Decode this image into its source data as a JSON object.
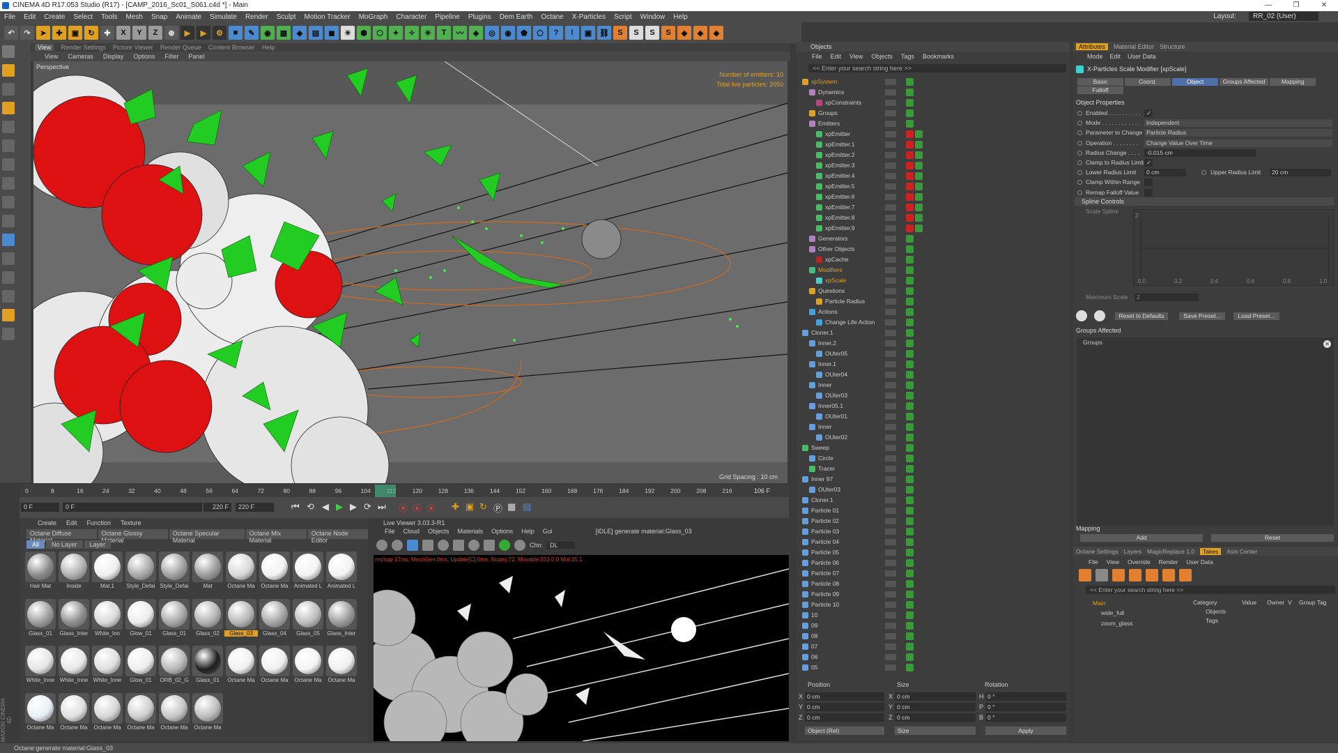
{
  "window": {
    "title": "CINEMA 4D R17.053 Studio (R17) - [CAMP_2016_Sc01_S061.c4d *] - Main"
  },
  "menu": [
    "File",
    "Edit",
    "Create",
    "Select",
    "Tools",
    "Mesh",
    "Snap",
    "Animate",
    "Simulate",
    "Render",
    "Sculpt",
    "Motion Tracker",
    "MoGraph",
    "Character",
    "Pipeline",
    "Plugins",
    "Dem Earth",
    "Octane",
    "X-Particles",
    "Script",
    "Window",
    "Help"
  ],
  "layout": {
    "label": "Layout:",
    "value": "RR_02 (User)"
  },
  "viewport": {
    "tabs": [
      "View",
      "Render Settings",
      "Picture Viewer",
      "Render Queue",
      "Content Browser",
      "Help"
    ],
    "menu": [
      "View",
      "Cameras",
      "Display",
      "Options",
      "Filter",
      "Panel"
    ],
    "name": "Perspective",
    "emitters": "Number of emitters: 10",
    "particles": "Total live particles: 2050",
    "grid": "Grid Spacing : 10 cm"
  },
  "timeline": {
    "ticks": [
      "0",
      "8",
      "16",
      "24",
      "32",
      "40",
      "48",
      "56",
      "64",
      "72",
      "80",
      "88",
      "96",
      "104",
      "112",
      "120",
      "128",
      "136",
      "144",
      "152",
      "160",
      "168",
      "176",
      "184",
      "192",
      "200",
      "208",
      "216"
    ],
    "current": "106",
    "end_label": "106 F",
    "start_field": "0 F",
    "min_field": "0 F",
    "max_field": "220 F",
    "end_field": "220 F"
  },
  "materials": {
    "menu": [
      "Create",
      "Edit",
      "Function",
      "Texture"
    ],
    "tabs": [
      "Octane Diffuse Material",
      "Octane Glossy Material",
      "Octane Specular Material",
      "Octane Mix Material",
      "Octane Node Editor"
    ],
    "filters": [
      "All",
      "No Layer",
      "Layer"
    ],
    "items": [
      {
        "name": "Hair Mat",
        "c": "#8a8a8a"
      },
      {
        "name": "Inside",
        "c": "#b0b0b0"
      },
      {
        "name": "Mat.1",
        "c": "#f0f0f0"
      },
      {
        "name": "Style_Defai",
        "c": "#a8a8a8"
      },
      {
        "name": "Style_Defai",
        "c": "#a0a0a0"
      },
      {
        "name": "Mat",
        "c": "#9a9a9a"
      },
      {
        "name": "Octane Ma",
        "c": "#d8d8d8"
      },
      {
        "name": "Octane Ma",
        "c": "#f2f2f2"
      },
      {
        "name": "Animated L",
        "c": "#f2f2f2"
      },
      {
        "name": "Animated L",
        "c": "#f2f2f2"
      },
      {
        "name": "Glass_01",
        "c": "#9c9c9c"
      },
      {
        "name": "Glass_Inter",
        "c": "#8c8c8c"
      },
      {
        "name": "White_Inn",
        "c": "#dadada"
      },
      {
        "name": "Glow_01",
        "c": "#ececec"
      },
      {
        "name": "Glass_01",
        "c": "#a6a6a6"
      },
      {
        "name": "Glass_02",
        "c": "#b2b2b2"
      },
      {
        "name": "Glass_03",
        "c": "#b6b6b6",
        "sel": true
      },
      {
        "name": "Glass_04",
        "c": "#a4a4a4"
      },
      {
        "name": "Glass_05",
        "c": "#bdbdbd"
      },
      {
        "name": "Glass_Inter",
        "c": "#9a9a9a"
      },
      {
        "name": "White_Inne",
        "c": "#e4e4e4"
      },
      {
        "name": "White_Inne",
        "c": "#e8e8e8"
      },
      {
        "name": "White_Inne",
        "c": "#dedede"
      },
      {
        "name": "Glow_01",
        "c": "#eeeeee"
      },
      {
        "name": "ORB_02_G",
        "c": "#b8b8b8"
      },
      {
        "name": "Glass_01",
        "c": "#1e1e1e"
      },
      {
        "name": "Octane Ma",
        "c": "#f0f0f0"
      },
      {
        "name": "Octane Ma",
        "c": "#f0f0f0"
      },
      {
        "name": "Octane Ma",
        "c": "#f4f4f4"
      },
      {
        "name": "Octane Ma",
        "c": "#f0f0f0"
      },
      {
        "name": "Octane Ma",
        "c": "#e6f0f6"
      },
      {
        "name": "Octane Ma",
        "c": "#e0e0e0"
      },
      {
        "name": "Octane Ma",
        "c": "#d6d6d6"
      },
      {
        "name": "Octane Ma",
        "c": "#cfcfcf"
      },
      {
        "name": "Octane Ma",
        "c": "#c6c6c6"
      },
      {
        "name": "Octane Ma",
        "c": "#bcbcbc"
      }
    ]
  },
  "liveviewer": {
    "title": "Live Viewer 3.03.3-R1",
    "menu": [
      "File",
      "Cloud",
      "Objects",
      "Materials",
      "Options",
      "Help",
      "Gui"
    ],
    "status": "[IDLE] generate material:Glass_03",
    "chn_label": "Chn:",
    "chn": "DL",
    "msg": "ms/spp 17ms, MeshGen:0ms, Update[C]:0ms, Nodes:72, Movable:553 0 0 Mot:35.1"
  },
  "objects": {
    "header": "Objects",
    "menu": [
      "File",
      "Edit",
      "View",
      "Objects",
      "Tags",
      "Bookmarks"
    ],
    "search": "<< Enter your search string here >>",
    "rows": [
      {
        "n": "xpSystem",
        "d": 0,
        "c": "#e0a020",
        "sel": true
      },
      {
        "n": "Dynamics",
        "d": 1,
        "c": "#b080c0"
      },
      {
        "n": "xpConstraints",
        "d": 2,
        "c": "#c04080"
      },
      {
        "n": "Groups",
        "d": 1,
        "c": "#e0a020"
      },
      {
        "n": "Emitters",
        "d": 1,
        "c": "#b080c0"
      },
      {
        "n": "xpEmitter",
        "d": 2,
        "c": "#40c060",
        "t": true
      },
      {
        "n": "xpEmitter.1",
        "d": 2,
        "c": "#40c060",
        "t": true
      },
      {
        "n": "xpEmitter.2",
        "d": 2,
        "c": "#40c060",
        "t": true
      },
      {
        "n": "xpEmitter.3",
        "d": 2,
        "c": "#40c060",
        "t": true
      },
      {
        "n": "xpEmitter.4",
        "d": 2,
        "c": "#40c060",
        "t": true
      },
      {
        "n": "xpEmitter.5",
        "d": 2,
        "c": "#40c060",
        "t": true
      },
      {
        "n": "xpEmitter.6",
        "d": 2,
        "c": "#40c060",
        "t": true
      },
      {
        "n": "xpEmitter.7",
        "d": 2,
        "c": "#40c060",
        "t": true
      },
      {
        "n": "xpEmitter.8",
        "d": 2,
        "c": "#40c060",
        "t": true
      },
      {
        "n": "xpEmitter.9",
        "d": 2,
        "c": "#40c060",
        "t": true
      },
      {
        "n": "Generators",
        "d": 1,
        "c": "#b080c0"
      },
      {
        "n": "Other Objects",
        "d": 1,
        "c": "#b080c0"
      },
      {
        "n": "xpCache",
        "d": 2,
        "c": "#c02020"
      },
      {
        "n": "Modifiers",
        "d": 1,
        "c": "#40c080",
        "sel": true
      },
      {
        "n": "xpScale",
        "d": 2,
        "c": "#40d0d0",
        "sel": true
      },
      {
        "n": "Questions",
        "d": 1,
        "c": "#e0a020"
      },
      {
        "n": "Particle Radius",
        "d": 2,
        "c": "#e0a020"
      },
      {
        "n": "Actions",
        "d": 1,
        "c": "#40a0e0"
      },
      {
        "n": "Change Life Action",
        "d": 2,
        "c": "#40a0e0"
      },
      {
        "n": "Cloner.1",
        "d": 0,
        "c": "#60a0e0"
      },
      {
        "n": "Inner.2",
        "d": 1,
        "c": "#60a0e0"
      },
      {
        "n": "OUter05",
        "d": 2,
        "c": "#60a0e0"
      },
      {
        "n": "Inner.1",
        "d": 1,
        "c": "#60a0e0"
      },
      {
        "n": "OUter04",
        "d": 2,
        "c": "#60a0e0"
      },
      {
        "n": "Inner",
        "d": 1,
        "c": "#60a0e0"
      },
      {
        "n": "OUter03",
        "d": 2,
        "c": "#60a0e0"
      },
      {
        "n": "Inner05.1",
        "d": 1,
        "c": "#60a0e0"
      },
      {
        "n": "OUter01",
        "d": 2,
        "c": "#60a0e0"
      },
      {
        "n": "Inner",
        "d": 1,
        "c": "#60a0e0"
      },
      {
        "n": "OUter02",
        "d": 2,
        "c": "#60a0e0"
      },
      {
        "n": "Sweep",
        "d": 0,
        "c": "#40c060"
      },
      {
        "n": "Circle",
        "d": 1,
        "c": "#60a0e0"
      },
      {
        "n": "Tracer",
        "d": 1,
        "c": "#40c060"
      },
      {
        "n": "Inner 97",
        "d": 0,
        "c": "#60a0e0"
      },
      {
        "n": "OUter03",
        "d": 1,
        "c": "#60a0e0"
      },
      {
        "n": "Cloner.1",
        "d": 0,
        "c": "#60a0e0"
      },
      {
        "n": "Particle 01",
        "d": 0,
        "c": "#60a0e0"
      },
      {
        "n": "Particle 02",
        "d": 0,
        "c": "#60a0e0"
      },
      {
        "n": "Particle 03",
        "d": 0,
        "c": "#60a0e0"
      },
      {
        "n": "Particle 04",
        "d": 0,
        "c": "#60a0e0"
      },
      {
        "n": "Particle 05",
        "d": 0,
        "c": "#60a0e0"
      },
      {
        "n": "Particle 06",
        "d": 0,
        "c": "#60a0e0"
      },
      {
        "n": "Particle 07",
        "d": 0,
        "c": "#60a0e0"
      },
      {
        "n": "Particle 08",
        "d": 0,
        "c": "#60a0e0"
      },
      {
        "n": "Particle 09",
        "d": 0,
        "c": "#60a0e0"
      },
      {
        "n": "Particle 10",
        "d": 0,
        "c": "#60a0e0"
      },
      {
        "n": "10",
        "d": 0,
        "c": "#60a0e0"
      },
      {
        "n": "09",
        "d": 0,
        "c": "#60a0e0"
      },
      {
        "n": "08",
        "d": 0,
        "c": "#60a0e0"
      },
      {
        "n": "07",
        "d": 0,
        "c": "#60a0e0"
      },
      {
        "n": "06",
        "d": 0,
        "c": "#60a0e0"
      },
      {
        "n": "05",
        "d": 0,
        "c": "#60a0e0"
      }
    ]
  },
  "coords": {
    "headers": [
      "Position",
      "Size",
      "Rotation"
    ],
    "x": "0 cm",
    "y": "0 cm",
    "z": "0 cm",
    "sx": "0 cm",
    "sy": "0 cm",
    "sz": "0 cm",
    "h": "0 °",
    "p": "0 °",
    "b": "0 °",
    "mode": "Object (Rel)",
    "size_mode": "Size",
    "apply": "Apply"
  },
  "attributes": {
    "tabs": [
      "Attributes",
      "Material Editor",
      "Structure"
    ],
    "menu": [
      "Mode",
      "Edit",
      "User Data"
    ],
    "object": "X-Particles Scale Modifier [xpScale]",
    "subtabs": [
      "Basic",
      "Coord.",
      "Object",
      "Groups Affected",
      "Mapping",
      "Falloff"
    ],
    "section": "Object Properties",
    "props": [
      {
        "l": "Enabled . . . . . . . . . .",
        "v": "✓"
      },
      {
        "l": "Mode . . . . . . . . . . . .",
        "v": "Independent"
      },
      {
        "l": "Parameter to Change",
        "v": "Particle Radius"
      },
      {
        "l": "Operation . . . . . . . .",
        "v": "Change Value Over Time"
      },
      {
        "l": "Radius Change . . . .",
        "v": "-0.015 cm"
      },
      {
        "l": "Clamp to Radius Limit",
        "v": "✓"
      },
      {
        "l": "Lower Radius Limit",
        "v": "0 cm"
      },
      {
        "l": "Clamp Within Range",
        "v": ""
      },
      {
        "l": "Remap Falloff Value",
        "v": ""
      }
    ],
    "upper_label": "Upper Radius Limit",
    "upper_value": "20 cm",
    "spline_section": "Spline Controls",
    "scale_spline": "Scale Spline",
    "max_scale_label": "Maximum Scale",
    "max_scale_value": "2",
    "spline_y": "2",
    "spline_x": [
      "0.0",
      "0.2",
      "0.4",
      "0.6",
      "0.8",
      "1.0"
    ],
    "reset": "Reset to Defaults",
    "save": "Save Preset...",
    "load": "Load Preset...",
    "groups_section": "Groups Affected",
    "groups_label": "Groups",
    "mapping": "Mapping",
    "add": "Add",
    "reset2": "Reset"
  },
  "takes": {
    "tabs": [
      "Octane Settings",
      "Layers",
      "MagicReplace 1.0",
      "Takes",
      "Asis Center"
    ],
    "menu": [
      "File",
      "View",
      "Override",
      "Render",
      "User Data"
    ],
    "search": "<< Enter your search string here >>",
    "main": "Main",
    "t1": "wide_full",
    "t2": "zoom_glass",
    "cols": [
      "Category",
      "Value",
      "Owner",
      "V",
      "Group Tag"
    ],
    "cat1": "Objects",
    "cat2": "Tags"
  },
  "status": "Octane:generate material:Glass_03",
  "maxon": "MAXON CINEMA 4D"
}
